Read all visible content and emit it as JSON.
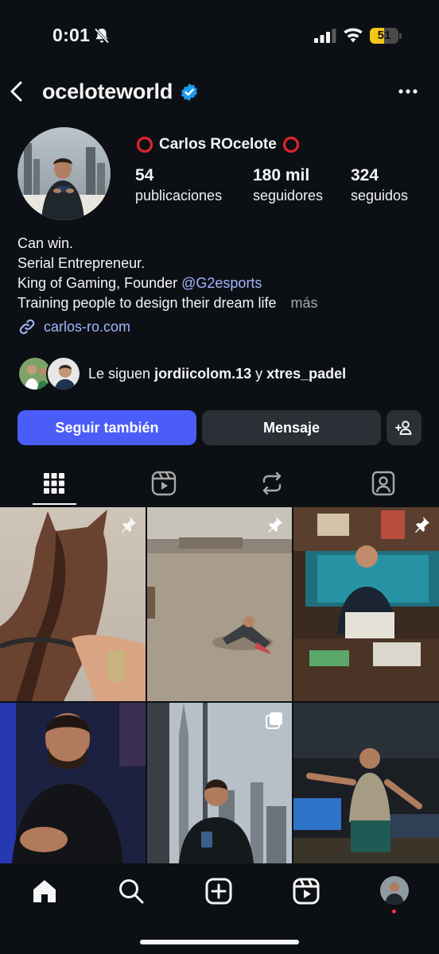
{
  "status_bar": {
    "time": "0:01",
    "battery": "51",
    "battery_level": 0.51,
    "icons": [
      "bell-slash-icon",
      "signal-icon",
      "wifi-icon",
      "battery-icon"
    ]
  },
  "header": {
    "username": "oceloteworld",
    "verified": true
  },
  "profile": {
    "display_name": "Carlos ROcelote",
    "stats": [
      {
        "value": "54",
        "label": "publicaciones"
      },
      {
        "value": "180 mil",
        "label": "seguidores"
      },
      {
        "value": "324",
        "label": "seguidos"
      }
    ],
    "bio": {
      "line1": "Can win.",
      "line2": "Serial Entrepreneur.",
      "line3_prefix": "King of Gaming, Founder ",
      "line3_mention": "@G2esports",
      "line4": "Training people to design their dream life",
      "more": "más"
    },
    "link": "carlos-ro.com",
    "followed_by": {
      "prefix": "Le siguen ",
      "user1": "jordiicolom.13",
      "conjunction": " y ",
      "user2": "xtres_padel"
    }
  },
  "actions": {
    "follow_back": "Seguir también",
    "message": "Mensaje"
  },
  "tabs": [
    "grid-icon",
    "reels-icon",
    "reposts-icon",
    "tagged-icon"
  ],
  "colors": {
    "background": "#0c1014",
    "accent": "#4a5df9",
    "link": "#a3b4ff",
    "secondary_button": "#2b3036"
  }
}
